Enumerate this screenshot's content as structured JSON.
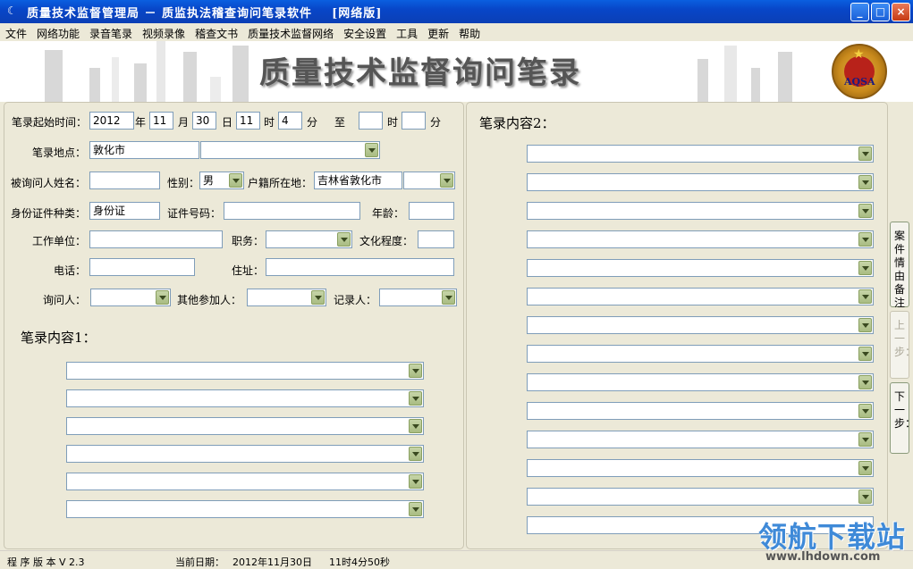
{
  "window": {
    "title": "质量技术监督管理局 － 质监执法稽查询问笔录软件    [网络版]",
    "buttons": [
      "_",
      "□",
      "×"
    ]
  },
  "menu": [
    "文件",
    "网络功能",
    "录音笔录",
    "视频录像",
    "稽查文书",
    "质量技术监督网络",
    "安全设置",
    "工具",
    "更新",
    "帮助"
  ],
  "banner": {
    "title": "质量技术监督询问笔录",
    "emblem_text": "AQSA"
  },
  "form": {
    "start_time_label": "笔录起始时间：",
    "year": "2012",
    "year_unit": "年",
    "month": "11",
    "month_unit": "月",
    "day": "30",
    "day_unit": "日",
    "hour": "11",
    "hour_unit": "时",
    "minute": "4",
    "minute_unit": "分",
    "to_label": "至",
    "end_hour": "",
    "end_hour_unit": "时",
    "end_minute": "",
    "end_minute_unit": "分",
    "location_label": "笔录地点：",
    "location_value": "敦化市",
    "location_detail": "",
    "name_label": "被询问人姓名：",
    "name_value": "",
    "gender_label": "性别：",
    "gender_value": "男",
    "domicile_label": "户籍所在地：",
    "domicile_value": "吉林省敦化市",
    "id_type_label": "身份证件种类：",
    "id_type_value": "身份证",
    "id_no_label": "证件号码：",
    "id_no_value": "",
    "age_label": "年龄：",
    "age_value": "",
    "work_unit_label": "工作单位：",
    "work_unit_value": "",
    "position_label": "职务：",
    "position_value": "",
    "education_label": "文化程度：",
    "education_value": "",
    "phone_label": "电话：",
    "phone_value": "",
    "address_label": "住址：",
    "address_value": "",
    "interrogator_label": "询问人：",
    "others_label": "其他参加人：",
    "recorder_label": "记录人："
  },
  "content1": {
    "title": "笔录内容1："
  },
  "content2": {
    "title": "笔录内容2："
  },
  "side_buttons": {
    "case_note": "案件情由备注",
    "prev": "上一步：",
    "next": "下一步："
  },
  "status": {
    "version": "程 序 版 本 V 2.3",
    "date_label": "当前日期：",
    "date": "2012年11月30日",
    "time": "11时4分50秒"
  },
  "watermark": {
    "cn": "领航下载站",
    "url": "www.lhdown.com"
  },
  "colors": {
    "titlebar": "#0846c8",
    "background": "#ece9d8",
    "input_border": "#7f9db9",
    "dropdown_button": "#a9bc82"
  }
}
